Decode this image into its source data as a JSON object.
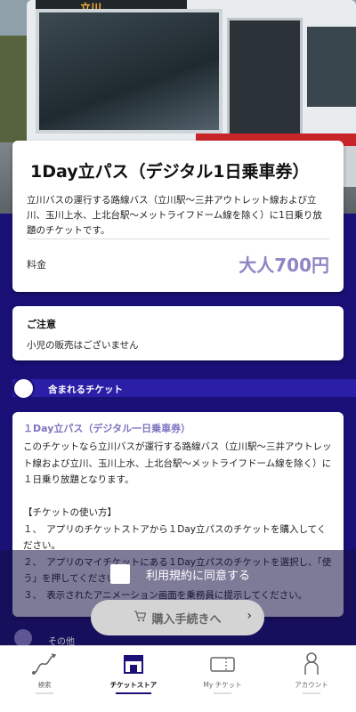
{
  "hero": {
    "sign_text": "立川"
  },
  "main": {
    "title": "1Day立パス（デジタル1日乗車券）",
    "description": "立川バスの運行する路線バス（立川駅〜三井アウトレット線および立川、玉川上水、上北台駅〜メットライフドーム線を除く）に1日乗り放題のチケットです。",
    "price_label": "料金",
    "price_value": "大人700円"
  },
  "notice": {
    "title": "ご注意",
    "text": "小児の販売はございません"
  },
  "included": {
    "label": "含まれるチケット"
  },
  "ticket": {
    "title": "１Day立パス（デジタル一日乗車券）",
    "body": "このチケットなら立川バスが運行する路線バス（立川駅〜三井アウトレット線および立川、玉川上水、上北台駅〜メットライフドーム線を除く）に１日乗り放題となります。\n\n【チケットの使い方】\n１、　アプリのチケットストアから１Day立パスのチケットを購入してください。\n２、　アプリのマイチケットにある１Day立パスのチケットを選択し、「使う」を押してください。\n３、　表示されたアニメーション画面を乗務員に提示してください。"
  },
  "agree": {
    "label": "利用規約に同意する"
  },
  "purchase": {
    "label": "購入手続きへ"
  },
  "other": {
    "label": "その他"
  },
  "tabs": [
    {
      "label": "検索",
      "icon": "route-icon"
    },
    {
      "label": "チケットストア",
      "icon": "store-icon"
    },
    {
      "label": "My チケット",
      "icon": "ticket-icon"
    },
    {
      "label": "アカウント",
      "icon": "person-icon"
    }
  ],
  "colors": {
    "background": "#1a1078",
    "accent": "#8e85c4",
    "section_bar": "#2b1fa8"
  }
}
